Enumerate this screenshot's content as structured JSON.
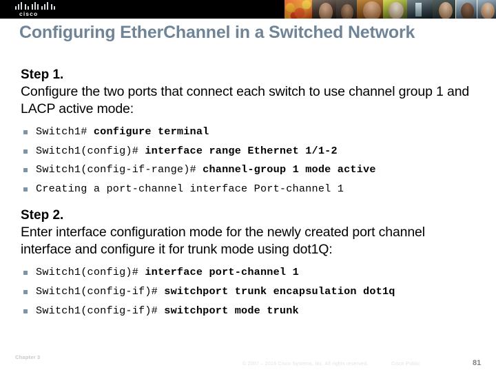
{
  "banner": {
    "logo_name": "cisco-logo",
    "logo_word": "cisco",
    "photo_strip_name": "people-photo-strip"
  },
  "slide": {
    "title": "Configuring EtherChannel in a Switched Network",
    "title_color": "#6f8497",
    "bullet_color": "#7d94a6"
  },
  "steps": [
    {
      "heading": "Step 1.",
      "description": "Configure the two ports that connect each switch to use channel group 1 and LACP active mode:",
      "commands": [
        {
          "prompt": "Switch1# ",
          "cmd": "configure terminal"
        },
        {
          "prompt": "Switch1(config)# ",
          "cmd": "interface range Ethernet 1/1-2"
        },
        {
          "prompt": "Switch1(config-if-range)# ",
          "cmd": "channel-group 1 mode active"
        },
        {
          "prompt": "Creating a port-channel interface Port-channel 1",
          "cmd": ""
        }
      ]
    },
    {
      "heading": "Step 2.",
      "description": "Enter interface configuration mode for the newly created port channel interface and configure it for trunk mode using dot1Q:",
      "commands": [
        {
          "prompt": "Switch1(config)# ",
          "cmd": "interface port-channel 1"
        },
        {
          "prompt": "Switch1(config-if)# ",
          "cmd": "switchport trunk encapsulation dot1q"
        },
        {
          "prompt": "Switch1(config-if)# ",
          "cmd": "switchport mode trunk"
        }
      ]
    }
  ],
  "footer": {
    "chapter": "Chapter 3",
    "copyright": "© 2007 – 2016 Cisco Systems, Inc. All rights reserved.",
    "classification": "Cisco Public",
    "page_number": "81"
  }
}
